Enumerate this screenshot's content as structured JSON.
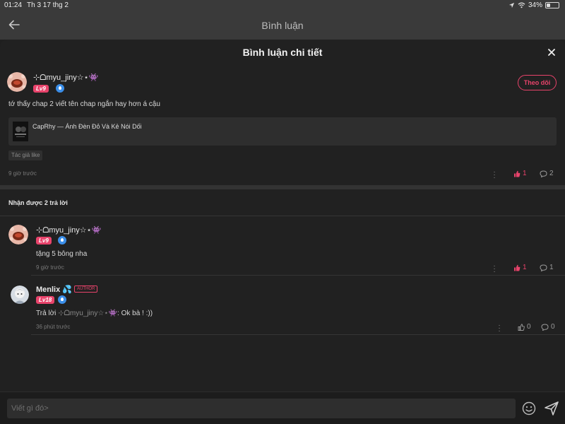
{
  "status_bar": {
    "time": "01:24",
    "date": "Th 3 17 thg 2",
    "battery": "34%",
    "battery_level": 0.34
  },
  "header": {
    "title": "Bình luận"
  },
  "sheet": {
    "title": "Bình luận chi tiết"
  },
  "main_comment": {
    "username": "⊹ᗝmyu_jiny☆⋆👾",
    "level": "Lv9",
    "follow_label": "Theo dõi",
    "text": "tớ thấy chap 2 viết tên chap ngắn hay hơn á cậu",
    "chapter": "CapRhy — Ánh Đèn Đỏ Và Kẻ Nói Dối",
    "author_like": "Tác giả like",
    "time": "9 giờ trước",
    "likes": "1",
    "replies": "2"
  },
  "replies_header": "Nhận được 2 trả lời",
  "replies": [
    {
      "username": "⊹ᗝmyu_jiny☆⋆👾",
      "level": "Lv9",
      "text": "tặng 5 bông nha",
      "time": "9 giờ trước",
      "likes": "1",
      "replies": "1"
    },
    {
      "username": "Menlix 💦",
      "author_tag": "AUTHOR",
      "level": "Lv18",
      "reply_prefix": "Trả lời",
      "reply_to": "⊹ᗝmyu_jiny☆⋆👾",
      "text": ": Ok bà ! :))",
      "time": "36 phút trước",
      "likes": "0",
      "replies": "0"
    }
  ],
  "composer": {
    "placeholder": "Viết gì đó>"
  },
  "colors": {
    "accent": "#e8436b",
    "badge_blue": "#3b8ee8",
    "background": "#212121"
  }
}
